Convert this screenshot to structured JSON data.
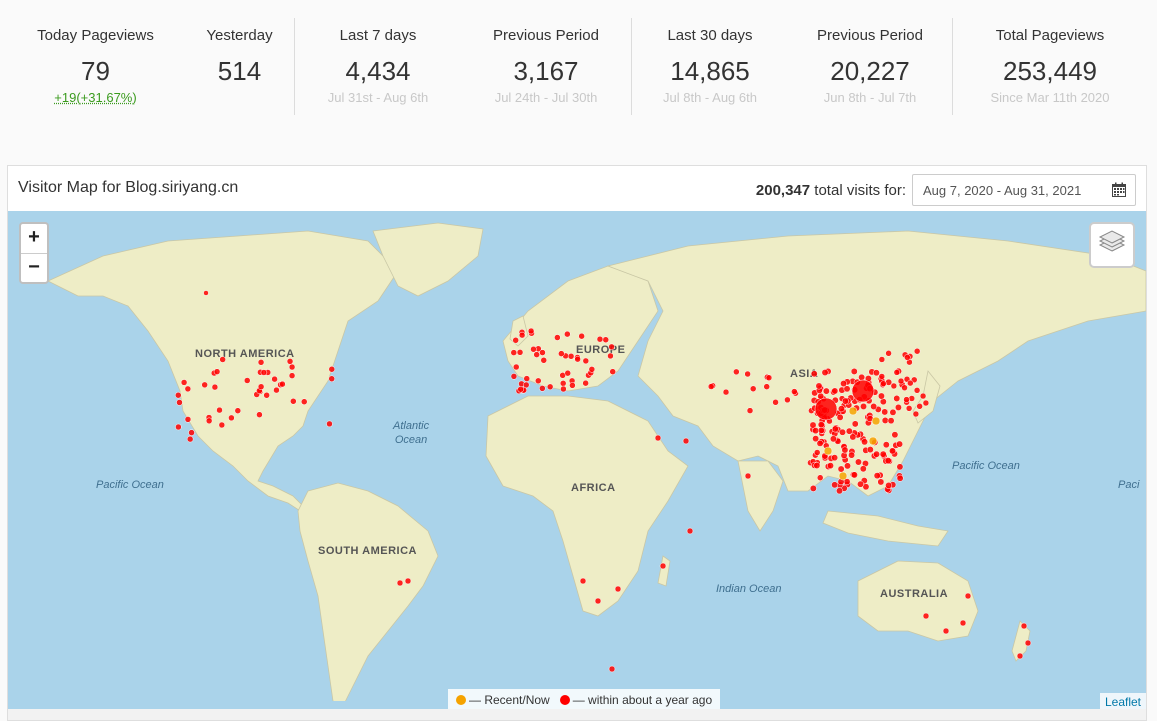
{
  "stats": {
    "today": {
      "label": "Today Pageviews",
      "value": "79",
      "sub": "+19(+31.67%)"
    },
    "yesterday": {
      "label": "Yesterday",
      "value": "514"
    },
    "last7": {
      "label": "Last 7 days",
      "value": "4,434",
      "sub": "Jul 31st - Aug 6th"
    },
    "prev7": {
      "label": "Previous Period",
      "value": "3,167",
      "sub": "Jul 24th - Jul 30th"
    },
    "last30": {
      "label": "Last 30 days",
      "value": "14,865",
      "sub": "Jul 8th - Aug 6th"
    },
    "prev30": {
      "label": "Previous Period",
      "value": "20,227",
      "sub": "Jun 8th - Jul 7th"
    },
    "total": {
      "label": "Total Pageviews",
      "value": "253,449",
      "sub": "Since Mar 11th 2020"
    }
  },
  "map_panel": {
    "title": "Visitor Map for Blog.siriyang.cn",
    "visits_count": "200,347",
    "visits_suffix": "total visits for:",
    "date_range": "Aug 7, 2020 - Aug 31, 2021",
    "calendar_icon": "calendar-icon",
    "zoom_in": "+",
    "zoom_out": "−",
    "layers_icon": "layers-icon",
    "legend_recent": "— Recent/Now",
    "legend_year": "— within about a year ago",
    "attribution": "Leaflet",
    "labels": {
      "north_america": "NORTH AMERICA",
      "south_america": "SOUTH AMERICA",
      "europe": "EUROPE",
      "asia": "ASIA",
      "africa": "AFRICA",
      "australia": "AUSTRALIA",
      "atlantic": "Atlantic\nOcean",
      "pacific_west": "Pacific Ocean",
      "pacific_east": "Pacific Ocean",
      "indian": "Indian Ocean",
      "pacific_edge": "Paci"
    }
  },
  "colors": {
    "recent": "#f5a300",
    "year": "#ff0000",
    "ocean": "#aad3ea",
    "land": "#f2efc8",
    "green_change": "#3b9b1e"
  }
}
